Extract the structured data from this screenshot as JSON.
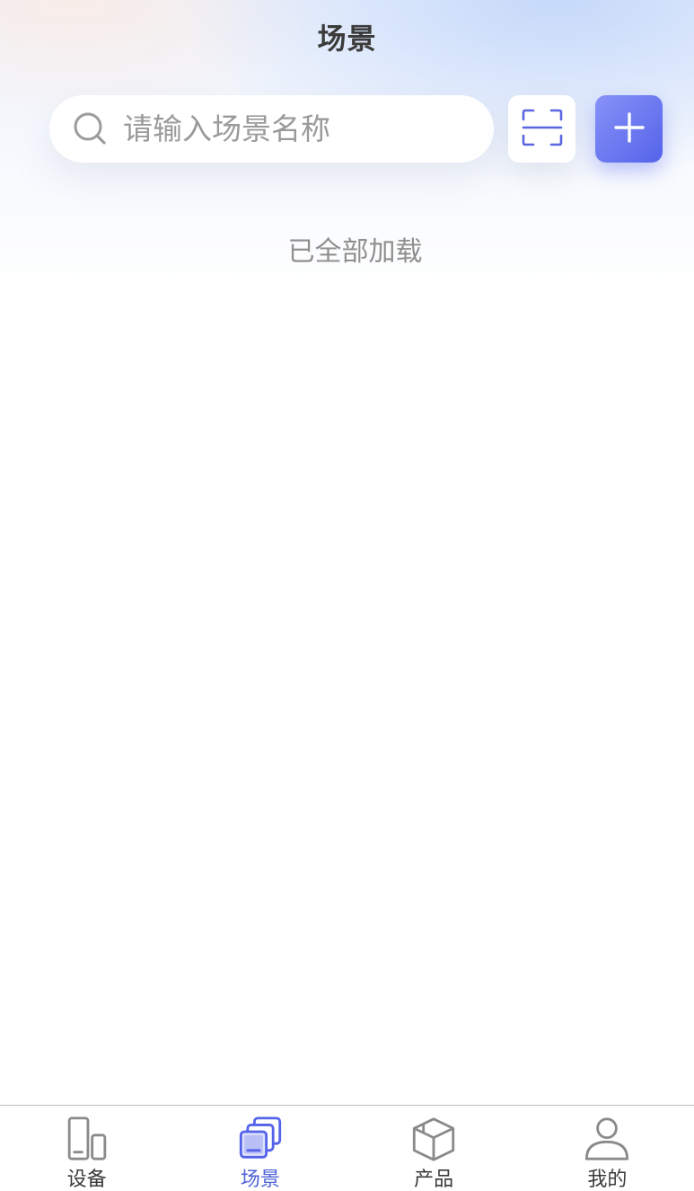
{
  "header": {
    "title": "场景"
  },
  "search": {
    "placeholder": "请输入场景名称",
    "value": ""
  },
  "list": {
    "status_text": "已全部加载"
  },
  "tabbar": {
    "items": [
      {
        "label": "设备",
        "icon": "device-icon",
        "active": false
      },
      {
        "label": "场景",
        "icon": "scene-icon",
        "active": true
      },
      {
        "label": "产品",
        "icon": "product-box-icon",
        "active": false
      },
      {
        "label": "我的",
        "icon": "user-icon",
        "active": false
      }
    ]
  },
  "colors": {
    "accent": "#5463ea",
    "accent_light": "#8792f7",
    "inactive_icon": "#8a8a8a",
    "title_text": "#3b3b3b"
  }
}
